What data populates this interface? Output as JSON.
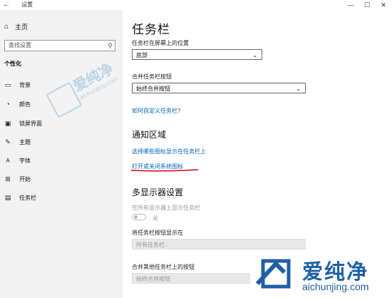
{
  "window": {
    "back_icon": "←",
    "title": "设置",
    "minimize": "—",
    "maximize": "☐",
    "close": "✕"
  },
  "sidebar": {
    "home": {
      "icon": "home-icon",
      "label": "主页"
    },
    "search": {
      "placeholder": "查找设置"
    },
    "section_title": "个性化",
    "items": [
      {
        "icon": "image-icon",
        "label": "背景"
      },
      {
        "icon": "palette-icon",
        "label": "颜色"
      },
      {
        "icon": "lock-screen-icon",
        "label": "锁屏界面"
      },
      {
        "icon": "theme-brush-icon",
        "label": "主题"
      },
      {
        "icon": "font-icon",
        "label": "字体"
      },
      {
        "icon": "start-menu-icon",
        "label": "开始"
      },
      {
        "icon": "taskbar-icon",
        "label": "任务栏"
      }
    ]
  },
  "main": {
    "title": "任务栏",
    "position": {
      "label": "任务栏在屏幕上的位置",
      "value": "底部"
    },
    "combine": {
      "label": "合并任务栏按钮",
      "value": "始终合并按钮"
    },
    "customize_link": "如何自定义任务栏?",
    "notification": {
      "title": "通知区域",
      "link1": "选择哪些图标显示在任务栏上",
      "link2": "打开或关闭系统图标"
    },
    "multi_display": {
      "title": "多显示器设置",
      "show_all_label": "在所有显示器上显示任务栏",
      "toggle_state": "关",
      "show_buttons_label": "将任务栏按钮显示在",
      "show_buttons_value": "所有任务栏",
      "other_combine_label": "合并其他任务栏上的按钮",
      "other_combine_value": "始终合并按钮"
    }
  },
  "watermark": {
    "cn": "爱纯净",
    "en": "aichunjing.com"
  },
  "colors": {
    "sidebar_bg": "#f2f2f2",
    "link": "#0066b4",
    "underline": "#d0021b",
    "watermark": "#1f5fa8"
  }
}
